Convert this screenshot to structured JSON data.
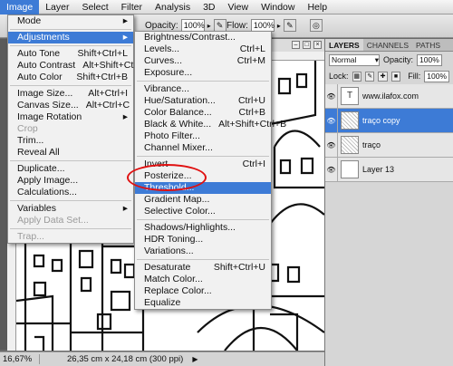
{
  "menubar": [
    "Image",
    "Layer",
    "Select",
    "Filter",
    "Analysis",
    "3D",
    "View",
    "Window",
    "Help"
  ],
  "options": {
    "opacity_label": "Opacity:",
    "opacity_value": "100%",
    "flow_label": "Flow:",
    "flow_value": "100%"
  },
  "image_menu": [
    {
      "label": "Mode",
      "shortcut": "",
      "submenu": true
    },
    {
      "sep": true
    },
    {
      "label": "Adjustments",
      "shortcut": "",
      "submenu": true,
      "highlight": true
    },
    {
      "sep": true
    },
    {
      "label": "Auto Tone",
      "shortcut": "Shift+Ctrl+L"
    },
    {
      "label": "Auto Contrast",
      "shortcut": "Alt+Shift+Ctrl+L"
    },
    {
      "label": "Auto Color",
      "shortcut": "Shift+Ctrl+B"
    },
    {
      "sep": true
    },
    {
      "label": "Image Size...",
      "shortcut": "Alt+Ctrl+I"
    },
    {
      "label": "Canvas Size...",
      "shortcut": "Alt+Ctrl+C"
    },
    {
      "label": "Image Rotation",
      "shortcut": "",
      "submenu": true
    },
    {
      "label": "Crop",
      "shortcut": "",
      "disabled": true
    },
    {
      "label": "Trim...",
      "shortcut": ""
    },
    {
      "label": "Reveal All",
      "shortcut": ""
    },
    {
      "sep": true
    },
    {
      "label": "Duplicate...",
      "shortcut": ""
    },
    {
      "label": "Apply Image...",
      "shortcut": ""
    },
    {
      "label": "Calculations...",
      "shortcut": ""
    },
    {
      "sep": true
    },
    {
      "label": "Variables",
      "shortcut": "",
      "submenu": true
    },
    {
      "label": "Apply Data Set...",
      "shortcut": "",
      "disabled": true
    },
    {
      "sep": true
    },
    {
      "label": "Trap...",
      "shortcut": "",
      "disabled": true
    }
  ],
  "adjustments_menu": [
    {
      "label": "Brightness/Contrast...",
      "shortcut": ""
    },
    {
      "label": "Levels...",
      "shortcut": "Ctrl+L"
    },
    {
      "label": "Curves...",
      "shortcut": "Ctrl+M"
    },
    {
      "label": "Exposure...",
      "shortcut": ""
    },
    {
      "sep": true
    },
    {
      "label": "Vibrance...",
      "shortcut": ""
    },
    {
      "label": "Hue/Saturation...",
      "shortcut": "Ctrl+U"
    },
    {
      "label": "Color Balance...",
      "shortcut": "Ctrl+B"
    },
    {
      "label": "Black & White...",
      "shortcut": "Alt+Shift+Ctrl+B"
    },
    {
      "label": "Photo Filter...",
      "shortcut": ""
    },
    {
      "label": "Channel Mixer...",
      "shortcut": ""
    },
    {
      "sep": true
    },
    {
      "label": "Invert",
      "shortcut": "Ctrl+I"
    },
    {
      "label": "Posterize...",
      "shortcut": ""
    },
    {
      "label": "Threshold...",
      "shortcut": "",
      "highlight": true
    },
    {
      "label": "Gradient Map...",
      "shortcut": ""
    },
    {
      "label": "Selective Color...",
      "shortcut": ""
    },
    {
      "sep": true
    },
    {
      "label": "Shadows/Highlights...",
      "shortcut": ""
    },
    {
      "label": "HDR Toning...",
      "shortcut": ""
    },
    {
      "label": "Variations...",
      "shortcut": ""
    },
    {
      "sep": true
    },
    {
      "label": "Desaturate",
      "shortcut": "Shift+Ctrl+U"
    },
    {
      "label": "Match Color...",
      "shortcut": ""
    },
    {
      "label": "Replace Color...",
      "shortcut": ""
    },
    {
      "label": "Equalize",
      "shortcut": ""
    }
  ],
  "panel": {
    "tabs": [
      "LAYERS",
      "CHANNELS",
      "PATHS"
    ],
    "blend_mode": "Normal",
    "opacity_label": "Opacity:",
    "opacity_value": "100%",
    "lock_label": "Lock:",
    "fill_label": "Fill:",
    "fill_value": "100%",
    "layers": [
      {
        "name": "www.ilafox.com",
        "thumb": "T",
        "selected": false,
        "visible": true
      },
      {
        "name": "traço copy",
        "thumb": "texture",
        "selected": true,
        "visible": true
      },
      {
        "name": "traço",
        "thumb": "texture",
        "selected": false,
        "visible": true
      },
      {
        "name": "Layer 13",
        "thumb": "white",
        "selected": false,
        "visible": true
      }
    ]
  },
  "status": {
    "zoom": "16,67%",
    "info": "26,35 cm x 24,18 cm (300 ppi)"
  }
}
